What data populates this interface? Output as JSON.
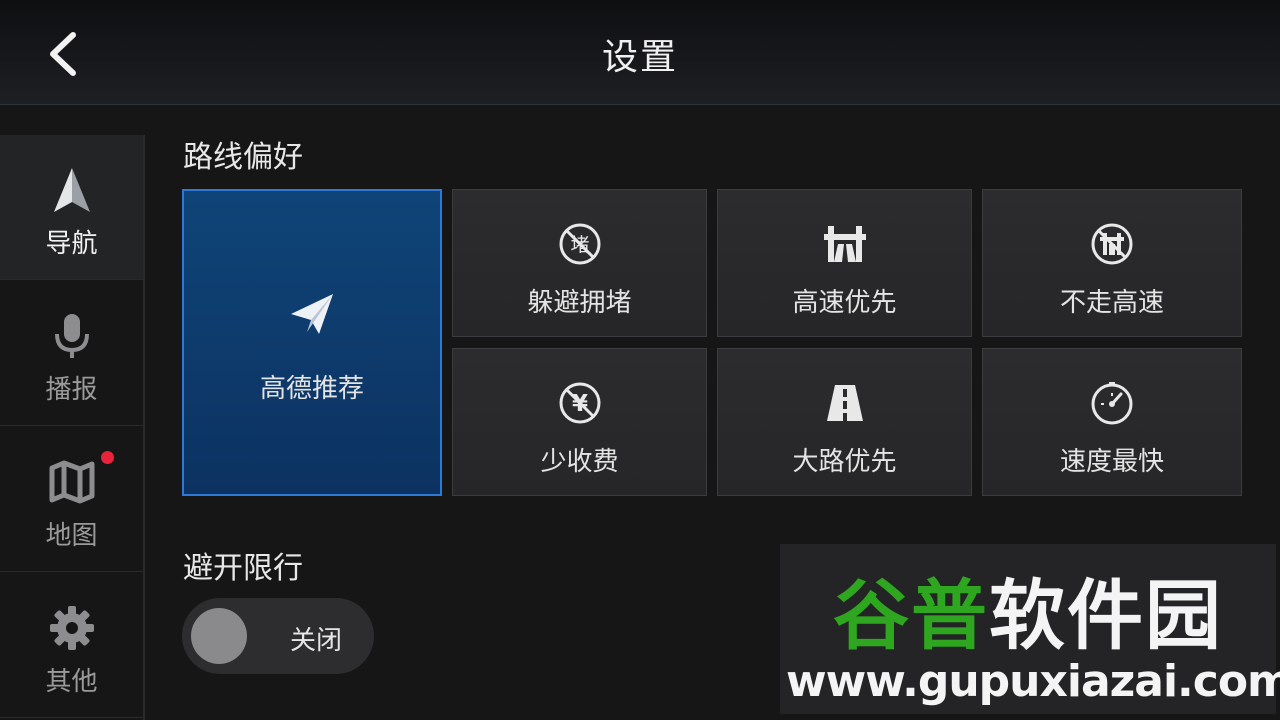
{
  "header": {
    "title": "设置",
    "back_icon": "chevron-left-icon"
  },
  "sidebar": {
    "items": [
      {
        "label": "导航",
        "icon": "navigation-arrow-icon",
        "active": true
      },
      {
        "label": "播报",
        "icon": "microphone-icon",
        "active": false
      },
      {
        "label": "地图",
        "icon": "map-icon",
        "active": false,
        "has_notification_dot": true
      },
      {
        "label": "其他",
        "icon": "gear-icon",
        "active": false
      }
    ]
  },
  "route_preference": {
    "title": "路线偏好",
    "options": [
      {
        "label": "高德推荐",
        "icon": "paper-plane-icon",
        "selected": true
      },
      {
        "label": "躲避拥堵",
        "icon": "avoid-congestion-icon",
        "selected": false
      },
      {
        "label": "高速优先",
        "icon": "highway-icon",
        "selected": false
      },
      {
        "label": "不走高速",
        "icon": "no-highway-icon",
        "selected": false
      },
      {
        "label": "少收费",
        "icon": "no-toll-icon",
        "selected": false
      },
      {
        "label": "大路优先",
        "icon": "main-road-icon",
        "selected": false
      },
      {
        "label": "速度最快",
        "icon": "speedometer-icon",
        "selected": false
      }
    ],
    "avoid_congestion_glyph": "堵",
    "no_toll_glyph": "¥"
  },
  "restriction": {
    "title": "避开限行",
    "toggle_label": "关闭",
    "enabled": false
  },
  "watermark": {
    "part1": "谷普",
    "part2": "软件园",
    "url": "www.gupuxiazai.com"
  },
  "colors": {
    "accent": "#2f7ad8",
    "selected_bg": "#0f4478",
    "notification": "#e8233a",
    "watermark_green": "#2ea61f"
  }
}
